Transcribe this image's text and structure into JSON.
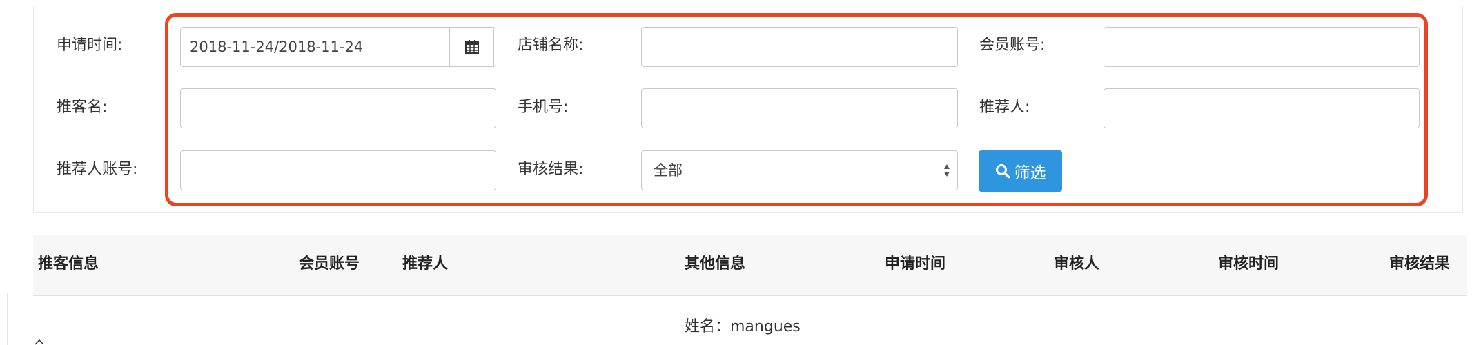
{
  "filters": {
    "apply_time_label": "申请时间:",
    "apply_time_value": "2018-11-24/2018-11-24",
    "store_name_label": "店铺名称:",
    "store_name_value": "",
    "member_account_label": "会员账号:",
    "member_account_value": "",
    "promoter_name_label": "推客名:",
    "promoter_name_value": "",
    "phone_label": "手机号:",
    "phone_value": "",
    "referrer_label": "推荐人:",
    "referrer_value": "",
    "referrer_account_label": "推荐人账号:",
    "referrer_account_value": "",
    "review_result_label": "审核结果:",
    "review_result_selected": "全部",
    "filter_button_label": "筛选"
  },
  "table": {
    "headers": [
      "推客信息",
      "会员账号",
      "推荐人",
      "其他信息",
      "申请时间",
      "审核人",
      "审核时间",
      "审核结果"
    ],
    "rows": [
      {
        "other_info_name": "姓名：mangues"
      }
    ]
  },
  "colors": {
    "highlight_border": "#ee4323",
    "primary_button": "#2d96de"
  },
  "icons": {
    "calendar": "calendar-icon",
    "search": "search-icon",
    "select_arrow": "select-arrow-icon"
  }
}
